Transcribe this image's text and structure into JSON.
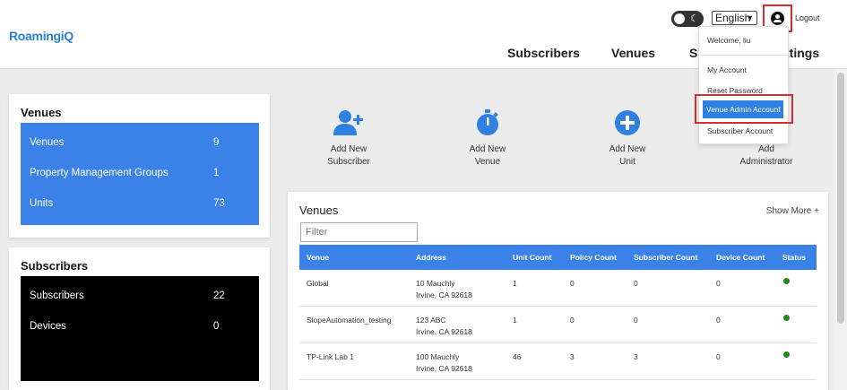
{
  "header": {
    "logo_main": "RoamingiQ",
    "logo_accent": "·",
    "language": "English",
    "logout": "Logout",
    "nav": [
      "Subscribers",
      "Venues",
      "S",
      "ttings"
    ]
  },
  "dropdown": {
    "welcome": "Welcome, liu",
    "items": [
      "My Account",
      "Reset Password",
      "Venue Admin Account",
      "Subscriber Account"
    ]
  },
  "venues_card": {
    "title": "Venues",
    "rows": [
      {
        "label": "Venues",
        "value": "9"
      },
      {
        "label": "Property Management Groups",
        "value": "1"
      },
      {
        "label": "Units",
        "value": "73"
      }
    ]
  },
  "subscribers_card": {
    "title": "Subscribers",
    "rows": [
      {
        "label": "Subscribers",
        "value": "22"
      },
      {
        "label": "Devices",
        "value": "0"
      }
    ]
  },
  "actions": [
    {
      "line1": "Add New",
      "line2": "Subscriber",
      "icon": "add-user-icon"
    },
    {
      "line1": "Add New",
      "line2": "Venue",
      "icon": "stopwatch-icon"
    },
    {
      "line1": "Add New",
      "line2": "Unit",
      "icon": "plus-circle-icon"
    },
    {
      "line1": "Add",
      "line2": "Administrator",
      "icon": "admin-icon"
    }
  ],
  "venues_table": {
    "title": "Venues",
    "show_more": "Show More +",
    "filter_placeholder": "Filter",
    "columns": [
      "Venue",
      "Address",
      "Unit Count",
      "Policy Count",
      "Subscriber Count",
      "Device Count",
      "Status"
    ],
    "rows": [
      {
        "venue": "Global",
        "addr1": "10 Mauchly",
        "addr2": "Irvine, CA 92618",
        "units": "1",
        "policies": "0",
        "subscribers": "0",
        "devices": "0"
      },
      {
        "venue": "SlopeAutomation_testing",
        "addr1": "123 ABC",
        "addr2": "Irvine, CA 92618",
        "units": "1",
        "policies": "0",
        "subscribers": "0",
        "devices": "0"
      },
      {
        "venue": "TP-Link Lab 1",
        "addr1": "100 Mauchly",
        "addr2": "Irvine, CA 92618",
        "units": "46",
        "policies": "3",
        "subscribers": "3",
        "devices": "0"
      }
    ]
  },
  "colors": {
    "primary_blue": "#3b82e8",
    "highlight_red": "#d32f2f",
    "status_green": "#1e8a1e"
  }
}
